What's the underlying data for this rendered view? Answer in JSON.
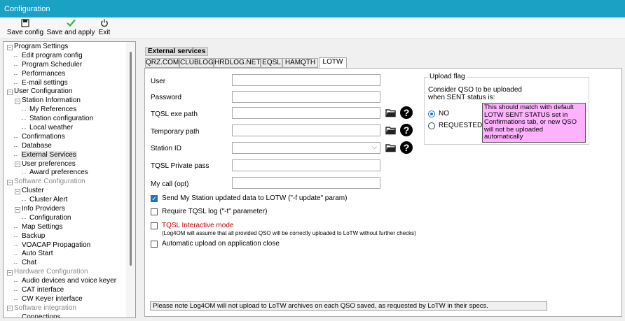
{
  "window": {
    "title": "Configuration"
  },
  "toolbar": {
    "save_config": "Save config",
    "save_and_apply": "Save and apply",
    "exit": "Exit"
  },
  "tree": [
    {
      "label": "Program Settings",
      "level": 0,
      "expander": true,
      "gray": false
    },
    {
      "label": "Edit program config",
      "level": 1
    },
    {
      "label": "Program Scheduler",
      "level": 1
    },
    {
      "label": "Performances",
      "level": 1
    },
    {
      "label": "E-mail settings",
      "level": 1
    },
    {
      "label": "User Configuration",
      "level": 0,
      "expander": true
    },
    {
      "label": "Station Information",
      "level": 1,
      "expander": true
    },
    {
      "label": "My References",
      "level": 2
    },
    {
      "label": "Station configuration",
      "level": 2
    },
    {
      "label": "Local weather",
      "level": 2
    },
    {
      "label": "Confirmations",
      "level": 1
    },
    {
      "label": "Database",
      "level": 1
    },
    {
      "label": "External Services",
      "level": 1,
      "selected": true
    },
    {
      "label": "User preferences",
      "level": 1,
      "expander": true
    },
    {
      "label": "Award preferences",
      "level": 2
    },
    {
      "label": "Software Configuration",
      "level": 0,
      "expander": true,
      "gray": true
    },
    {
      "label": "Cluster",
      "level": 1,
      "expander": true
    },
    {
      "label": "Cluster Alert",
      "level": 2
    },
    {
      "label": "Info Providers",
      "level": 1,
      "expander": true
    },
    {
      "label": "Configuration",
      "level": 2
    },
    {
      "label": "Map Settings",
      "level": 1
    },
    {
      "label": "Backup",
      "level": 1
    },
    {
      "label": "VOACAP Propagation",
      "level": 1
    },
    {
      "label": "Auto Start",
      "level": 1
    },
    {
      "label": "Chat",
      "level": 1
    },
    {
      "label": "Hardware Configuration",
      "level": 0,
      "expander": true,
      "gray": true
    },
    {
      "label": "Audio devices and voice keyer",
      "level": 1
    },
    {
      "label": "CAT interface",
      "level": 1
    },
    {
      "label": "CW Keyer interface",
      "level": 1
    },
    {
      "label": "Software integration",
      "level": 0,
      "expander": true,
      "gray": true
    },
    {
      "label": "Connections",
      "level": 1
    }
  ],
  "section": {
    "title": "External services"
  },
  "tabs": [
    "QRZ.COM",
    "CLUBLOG",
    "HRDLOG.NET",
    "EQSL",
    "HAMQTH",
    "LOTW"
  ],
  "active_tab": "LOTW",
  "form": {
    "user_label": "User",
    "user_value": "",
    "password_label": "Password",
    "password_value": "",
    "tqsl_exe_label": "TQSL exe path",
    "tqsl_exe_value": "",
    "temp_path_label": "Temporary path",
    "temp_path_value": "",
    "station_id_label": "Station ID",
    "station_id_value": "",
    "tqsl_pass_label": "TQSL Private pass",
    "tqsl_pass_value": "",
    "mycall_label": "My call (opt)",
    "mycall_value": ""
  },
  "checkboxes": {
    "send_station": {
      "label": "Send My Station updated data to LOTW (\"-f update\" param)",
      "checked": true
    },
    "require_log": {
      "label": "Require TQSL log (\"-t\" parameter)",
      "checked": false
    },
    "interactive": {
      "label": "TQSL Interactive mode",
      "checked": false,
      "note": "(Log4OM will assume that all provided QSO will be correctly uploaded to LoTW without further checks)"
    },
    "auto_upload": {
      "label": "Automatic upload on application close",
      "checked": false
    }
  },
  "upload_flag": {
    "title": "Upload flag",
    "description": "Consider QSO to be uploaded when SENT status is:",
    "option_no": "NO",
    "option_requested": "REQUESTED",
    "selected": "NO",
    "note": "This should match with default LOTW SENT STATUS set in Confirmations tab, or new QSO will not be uploaded automatically"
  },
  "footer": {
    "note": "Please note Log4OM will not upload to LoTW archives on each QSO saved, as requested by LoTW in their specs."
  },
  "colors": {
    "titlebar": "#1ba1c4",
    "note_background": "#ffb3ff",
    "checked": "#1a73c8",
    "warning_text": "#c00000"
  }
}
